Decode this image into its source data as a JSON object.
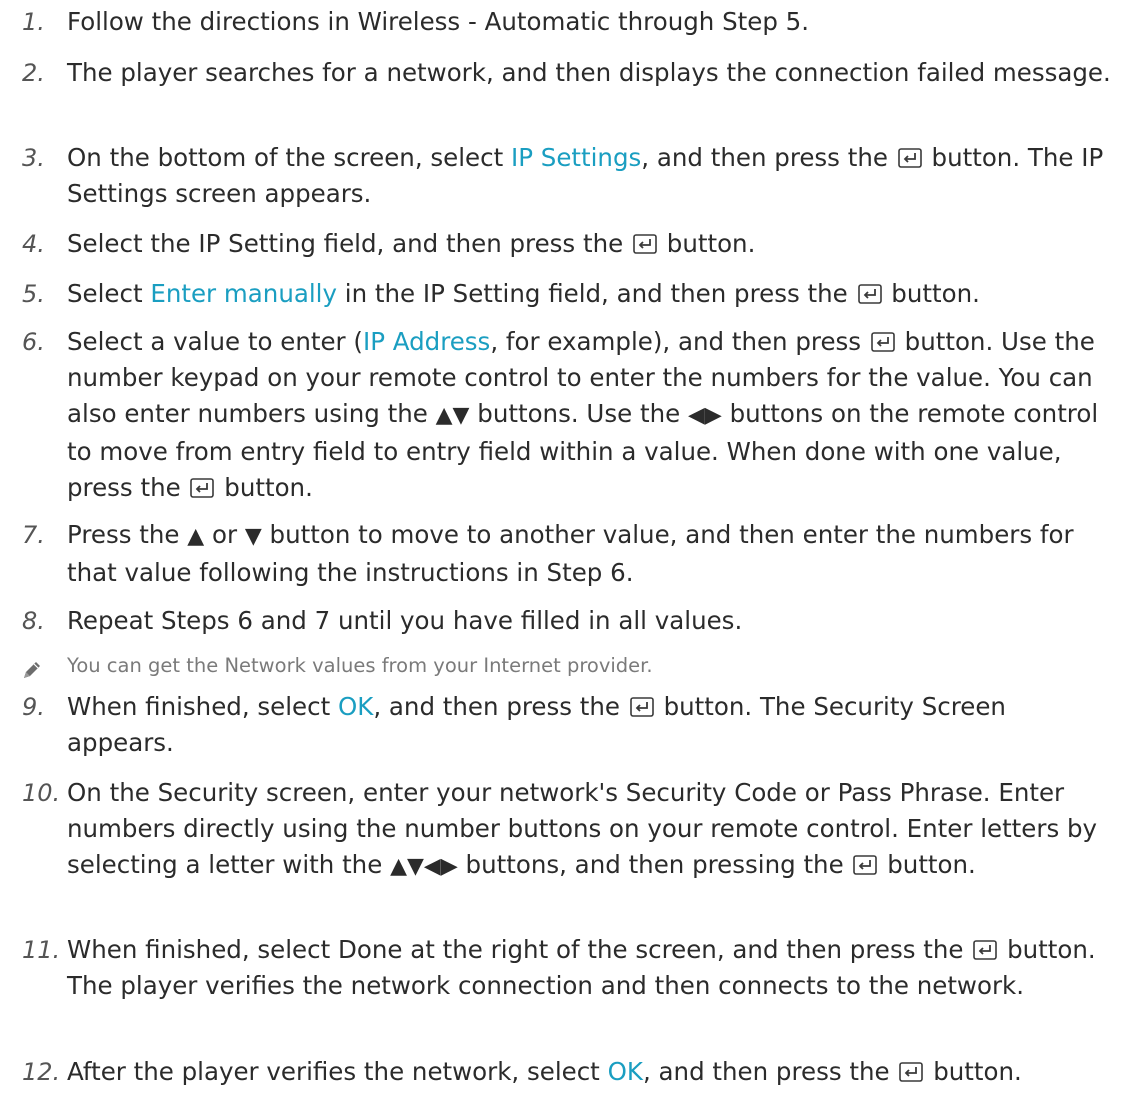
{
  "steps": [
    {
      "num": "1.",
      "segs": [
        {
          "t": "Follow the directions in Wireless - Automatic through Step 5."
        }
      ]
    },
    {
      "num": "2.",
      "segs": [
        {
          "t": "The player searches for a network, and then displays the connection failed message."
        }
      ]
    },
    {
      "num": "3.",
      "segs": [
        {
          "t": "On the bottom of the screen, select "
        },
        {
          "t": "IP Settings",
          "hl": true
        },
        {
          "t": ", and then press the "
        },
        {
          "icon": "enter"
        },
        {
          "t": " button. The IP Settings screen appears."
        }
      ]
    },
    {
      "num": "4.",
      "segs": [
        {
          "t": "Select the IP Setting field, and then press the "
        },
        {
          "icon": "enter"
        },
        {
          "t": " button."
        }
      ]
    },
    {
      "num": "5.",
      "segs": [
        {
          "t": "Select "
        },
        {
          "t": "Enter manually",
          "hl": true
        },
        {
          "t": " in the IP Setting field, and then press the "
        },
        {
          "icon": "enter"
        },
        {
          "t": " button."
        }
      ]
    },
    {
      "num": "6.",
      "segs": [
        {
          "t": "Select a value to enter ("
        },
        {
          "t": "IP Address",
          "hl": true
        },
        {
          "t": ", for example), and then press "
        },
        {
          "icon": "enter"
        },
        {
          "t": " button. Use the number keypad on your remote control to enter the numbers for the value. You can also enter numbers using the "
        },
        {
          "t": "▲▼",
          "key": true
        },
        {
          "t": " buttons. Use the "
        },
        {
          "t": "◀▶",
          "key": true
        },
        {
          "t": " buttons on the remote control to move from entry field to entry field within a value. When done with one value, press the "
        },
        {
          "icon": "enter"
        },
        {
          "t": " button."
        }
      ]
    },
    {
      "num": "7.",
      "segs": [
        {
          "t": "Press the "
        },
        {
          "t": "▲",
          "key": true
        },
        {
          "t": " or "
        },
        {
          "t": "▼",
          "key": true
        },
        {
          "t": " button to move to another value, and then enter the numbers for that value following the instructions in Step 6."
        }
      ]
    },
    {
      "num": "8.",
      "segs": [
        {
          "t": "Repeat Steps 6 and 7 until you have filled in all values."
        }
      ]
    },
    {
      "num": "9.",
      "segs": [
        {
          "t": "When finished, select "
        },
        {
          "t": "OK",
          "hl": true
        },
        {
          "t": ", and then press the "
        },
        {
          "icon": "enter"
        },
        {
          "t": " button. The Security Screen appears."
        }
      ]
    },
    {
      "num": "10.",
      "segs": [
        {
          "t": "On the Security screen, enter your network's Security Code or Pass Phrase. Enter numbers directly using the number buttons on your remote control. Enter letters by selecting a letter with the "
        },
        {
          "t": "▲▼◀▶",
          "key": true
        },
        {
          "t": " buttons, and then pressing the "
        },
        {
          "icon": "enter"
        },
        {
          "t": " button."
        }
      ]
    },
    {
      "num": "11.",
      "segs": [
        {
          "t": "When finished, select Done at the right of the screen, and then press the "
        },
        {
          "icon": "enter"
        },
        {
          "t": " button. The player verifies the network connection and then connects to the network."
        }
      ]
    },
    {
      "num": "12.",
      "segs": [
        {
          "t": "After the player verifies the network, select "
        },
        {
          "t": "OK",
          "hl": true
        },
        {
          "t": ", and then press the "
        },
        {
          "icon": "enter"
        },
        {
          "t": " button."
        }
      ]
    }
  ],
  "note": {
    "icon": "pencil-icon",
    "text": "You can get the Network values from your Internet provider."
  },
  "colors": {
    "text": "#2b2b2b",
    "highlight": "#1a9ec1",
    "note": "#7a7a7a"
  }
}
